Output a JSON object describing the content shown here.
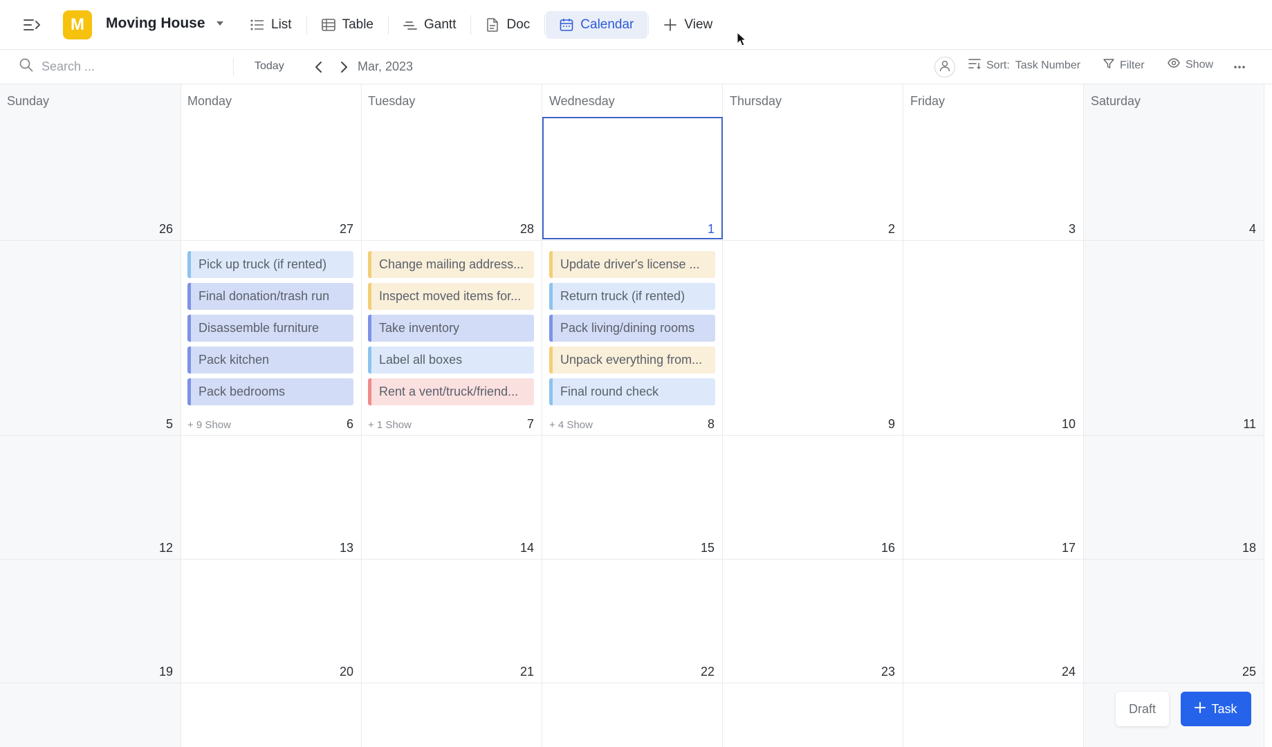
{
  "header": {
    "space_initial": "M",
    "space_name": "Moving House",
    "tabs": [
      {
        "label": "List",
        "icon": "list-icon"
      },
      {
        "label": "Table",
        "icon": "table-icon"
      },
      {
        "label": "Gantt",
        "icon": "gantt-icon"
      },
      {
        "label": "Doc",
        "icon": "doc-icon"
      },
      {
        "label": "Calendar",
        "icon": "calendar-icon",
        "active": true
      },
      {
        "label": "View",
        "icon": "plus-icon"
      }
    ],
    "colors": {
      "space_avatar": "#f7c20e",
      "accent": "#2f5bd6"
    }
  },
  "toolbar": {
    "search_placeholder": "Search ...",
    "today_label": "Today",
    "month_label": "Mar, 2023",
    "sort_label": "Sort:",
    "sort_value": "Task Number",
    "filter_label": "Filter",
    "show_label": "Show"
  },
  "calendar": {
    "day_names": [
      "Sunday",
      "Monday",
      "Tuesday",
      "Wednesday",
      "Thursday",
      "Friday",
      "Saturday"
    ],
    "weeks": [
      [
        "26",
        "27",
        "28",
        "1",
        "2",
        "3",
        "4"
      ],
      [
        "5",
        "6",
        "7",
        "8",
        "9",
        "10",
        "11"
      ],
      [
        "12",
        "13",
        "14",
        "15",
        "16",
        "17",
        "18"
      ],
      [
        "19",
        "20",
        "21",
        "22",
        "23",
        "24",
        "25"
      ]
    ],
    "today": "1",
    "tasks": {
      "monday_6": [
        {
          "title": "Pick up truck (if rented)",
          "color": "lblue"
        },
        {
          "title": "Final donation/trash run",
          "color": "indigo"
        },
        {
          "title": "Disassemble furniture",
          "color": "indigo"
        },
        {
          "title": "Pack kitchen",
          "color": "indigo"
        },
        {
          "title": "Pack bedrooms",
          "color": "indigo"
        }
      ],
      "tuesday_7": [
        {
          "title": "Change mailing address...",
          "color": "yellow"
        },
        {
          "title": "Inspect moved items for...",
          "color": "yellow"
        },
        {
          "title": "Take inventory",
          "color": "indigo"
        },
        {
          "title": "Label all boxes",
          "color": "lblue"
        },
        {
          "title": "Rent a vent/truck/friend...",
          "color": "red"
        }
      ],
      "wednesday_8": [
        {
          "title": "Update driver's license ...",
          "color": "yellow"
        },
        {
          "title": "Return truck (if rented)",
          "color": "lblue"
        },
        {
          "title": "Pack living/dining rooms",
          "color": "indigo"
        },
        {
          "title": "Unpack everything from...",
          "color": "yellow"
        },
        {
          "title": "Final round check",
          "color": "lblue"
        }
      ]
    },
    "more": {
      "monday_6": "+ 9 Show",
      "tuesday_7": "+ 1 Show",
      "wednesday_8": "+ 4 Show"
    }
  },
  "actions": {
    "draft_label": "Draft",
    "task_label": "Task"
  }
}
